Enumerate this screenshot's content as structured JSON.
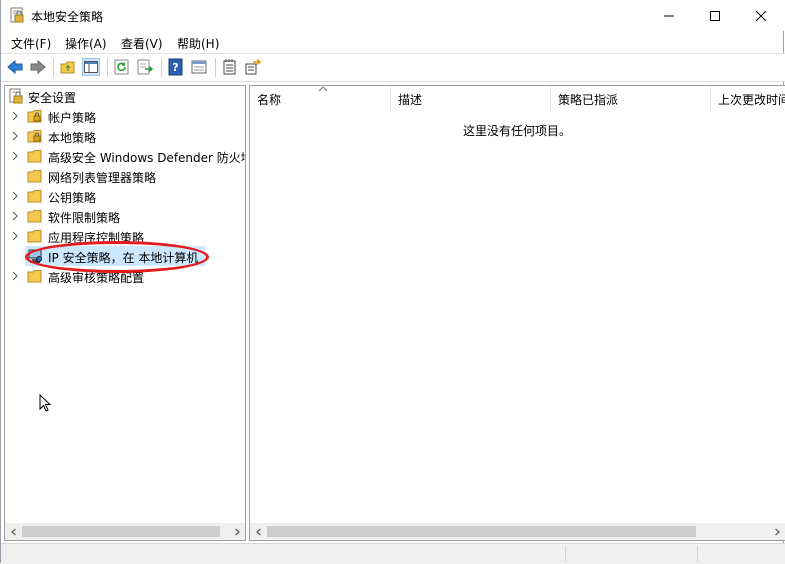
{
  "window": {
    "title": "本地安全策略",
    "icon": "security-policy-app-icon"
  },
  "menu": {
    "items": [
      {
        "label": "文件(F)"
      },
      {
        "label": "操作(A)"
      },
      {
        "label": "查看(V)"
      },
      {
        "label": "帮助(H)"
      }
    ]
  },
  "toolbar": {
    "icons": [
      "back-arrow-icon",
      "forward-arrow-icon",
      "up-folder-icon",
      "show-hide-tree-icon",
      "refresh-icon",
      "export-list-icon",
      "help-icon",
      "properties-icon",
      "notepad-icon",
      "move-tasks-icon"
    ]
  },
  "tree": {
    "root": "安全设置",
    "items": [
      {
        "label": "帐户策略",
        "expandable": true
      },
      {
        "label": "本地策略",
        "expandable": true
      },
      {
        "label": "高级安全 Windows Defender 防火墙",
        "expandable": true
      },
      {
        "label": "网络列表管理器策略",
        "expandable": false
      },
      {
        "label": "公钥策略",
        "expandable": true
      },
      {
        "label": "软件限制策略",
        "expandable": true
      },
      {
        "label": "应用程序控制策略",
        "expandable": true
      },
      {
        "label": "IP 安全策略，在 本地计算机",
        "expandable": false,
        "selected": true
      },
      {
        "label": "高级审核策略配置",
        "expandable": true
      }
    ]
  },
  "list": {
    "columns": [
      "名称",
      "描述",
      "策略已指派",
      "上次更改时间"
    ],
    "sorted_column": "名称",
    "empty_message": "这里没有任何项目。"
  },
  "colors": {
    "highlight": "#cce8ff",
    "annotation_circle": "#e31b1b",
    "folder": "#f2c94c"
  }
}
